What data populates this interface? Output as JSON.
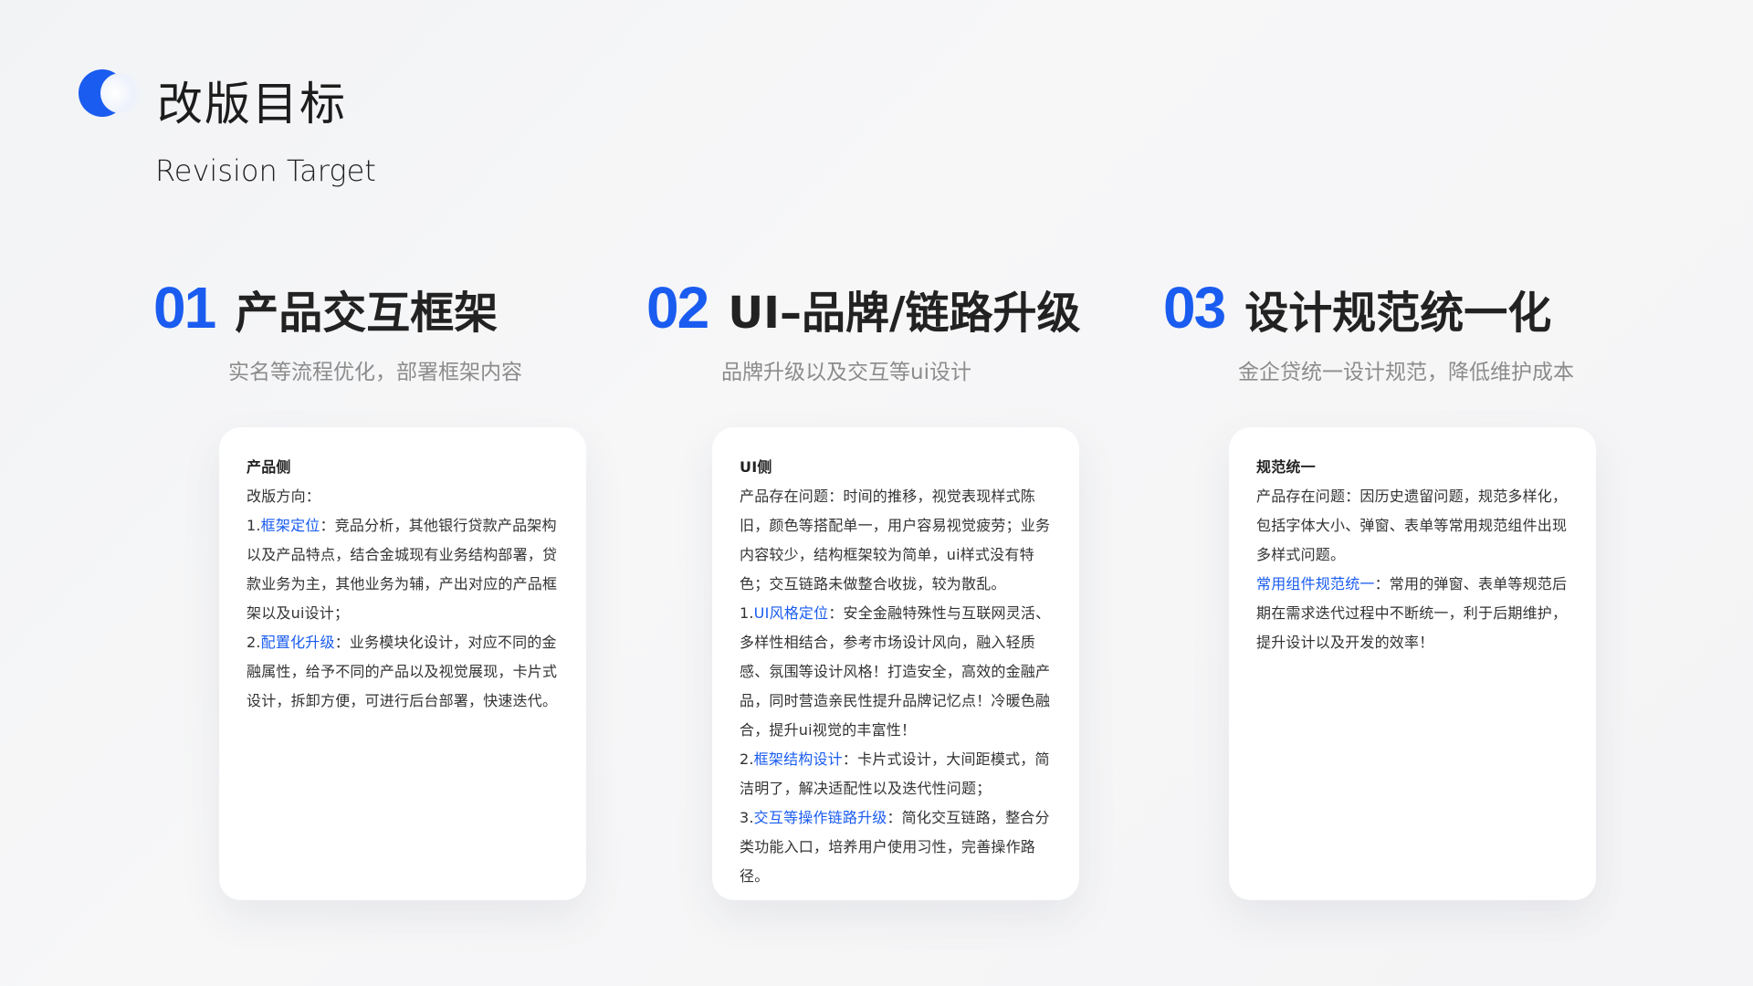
{
  "header": {
    "title": "改版目标",
    "subtitle": "Revision Target"
  },
  "sections": [
    {
      "number": "01",
      "title": "产品交互框架",
      "subtitle": "实名等流程优化，部署框架内容",
      "card": {
        "title": "产品侧",
        "intro": "改版方向：",
        "items": [
          {
            "prefix": "1.",
            "highlight": "框架定位",
            "text": "：竞品分析，其他银行贷款产品架构以及产品特点，结合金城现有业务结构部署，贷款业务为主，其他业务为辅，产出对应的产品框架以及ui设计；"
          },
          {
            "prefix": "2.",
            "highlight": "配置化升级",
            "text": "：业务模块化设计，对应不同的金融属性，给予不同的产品以及视觉展现，卡片式设计，拆卸方便，可进行后台部署，快速迭代。"
          }
        ]
      }
    },
    {
      "number": "02",
      "title": "UI–品牌/链路升级",
      "subtitle": "品牌升级以及交互等ui设计",
      "card": {
        "title": "UI侧",
        "intro": "产品存在问题：时间的推移，视觉表现样式陈旧，颜色等搭配单一，用户容易视觉疲劳；业务内容较少，结构框架较为简单，ui样式没有特色；交互链路未做整合收拢，较为散乱。",
        "items": [
          {
            "prefix": "1.",
            "highlight": "UI风格定位",
            "text": "：安全金融特殊性与互联网灵活、多样性相结合，参考市场设计风向，融入轻质感、氛围等设计风格！打造安全，高效的金融产品，同时营造亲民性提升品牌记忆点！冷暖色融合，提升ui视觉的丰富性！"
          },
          {
            "prefix": "2.",
            "highlight": "框架结构设计",
            "text": "：卡片式设计，大间距模式，简洁明了，解决适配性以及迭代性问题；"
          },
          {
            "prefix": "3.",
            "highlight": "交互等操作链路升级",
            "text": "：简化交互链路，整合分类功能入口，培养用户使用习性，完善操作路径。"
          }
        ]
      }
    },
    {
      "number": "03",
      "title": "设计规范统一化",
      "subtitle": "金企贷统一设计规范，降低维护成本",
      "card": {
        "title": "规范统一",
        "intro": "产品存在问题：因历史遗留问题，规范多样化，包括字体大小、弹窗、表单等常用规范组件出现多样式问题。",
        "items": [
          {
            "prefix": "",
            "highlight": "常用组件规范统一",
            "text": "：常用的弹窗、表单等规范后期在需求迭代过程中不断统一，利于后期维护，提升设计以及开发的效率！"
          }
        ]
      }
    }
  ],
  "colors": {
    "accent": "#1a5cf0",
    "muted": "#8c8c8c",
    "card_bg": "#ffffff"
  }
}
